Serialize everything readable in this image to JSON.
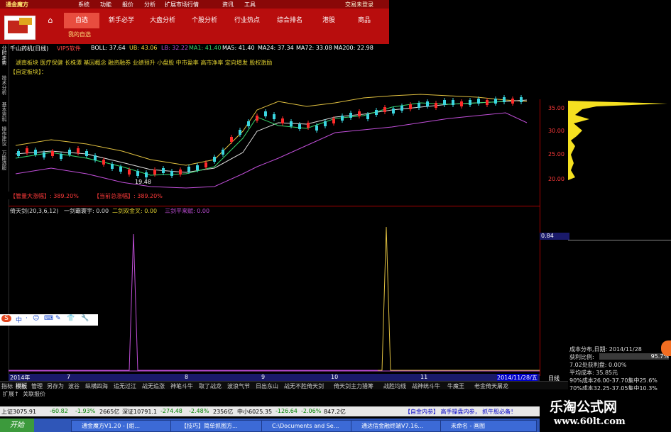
{
  "app": {
    "logo_text": "通金魔方",
    "login_text": "交易未登录",
    "menus": [
      "系统",
      "功能",
      "报价",
      "分析",
      "扩展市场行情",
      "资讯",
      "工具"
    ],
    "nav": [
      "自选",
      "新手必学",
      "大盘分析",
      "个股分析",
      "行业热点",
      "综合排名",
      "港股",
      "商品"
    ],
    "subnav": "我的自选"
  },
  "left_tabs": [
    "分时走势",
    "技术分析",
    "基本资料",
    "操作建议",
    "万能选股"
  ],
  "chart_header": {
    "title": "千山药机(日线)",
    "vip": "VIP5软件",
    "boll": "BOLL: 37.64",
    "ub": "UB: 43.06",
    "lb": "LB: 32.22",
    "ma1": "MA1: 41.40",
    "ma5": "MA5: 41.40",
    "ma24": "MA24: 37.34",
    "ma72": "MA72: 33.08",
    "ma200": "MA200: 22.98"
  },
  "concept_line": "湖南板块 医疗保健 长株潭 基因概念 融资融券 业绩预升 小盘股 中市盈率 高市净率 定向增发 股权激励",
  "custom_block": "【自定板块】：",
  "signals": {
    "left": "【管量大涨幅】: 389.20%",
    "right": "【当前总涨幅】: 389.20%"
  },
  "price_ticks": [
    "35.00",
    "30.00",
    "25.00",
    "20.00"
  ],
  "low_label": "19.48",
  "indicator": {
    "name": "倚天剑(20,3,6,12)",
    "a": "一剑霸寰宇: 0.00",
    "b": "二剑双金叉: 0.00",
    "c": "三剑平来赋: 0.00",
    "value_box": "0.84"
  },
  "dates": [
    "2014年",
    "7",
    "8",
    "9",
    "10",
    "11",
    "2014/11/28/五"
  ],
  "bottom_tabs": [
    "指标",
    "模板",
    "管理",
    "另存为",
    "波谷",
    "纵横四海",
    "追无过江",
    "战无追涨",
    "神笔斗牛",
    "取了战龙",
    "波浪气节",
    "日出东山",
    "战无不胜倚天剑",
    "倚天剑主力猎筹",
    "战胜均线",
    "战神统斗牛",
    "牛魔王",
    "老金倚天屠龙"
  ],
  "ext_tabs": [
    "扩展↑",
    "关联报价"
  ],
  "right_date_tab": "日线",
  "cost_panel": {
    "line1": "成本分布,日期: 2014/11/28",
    "line2": "获利比例:",
    "ratio": "95.7%",
    "line3": "7.02处获利盘: 0.00%",
    "line4": "平均成本: 35.85元",
    "line5": "90%成本26.00-37.70集中25.6%",
    "line6": "70%成本32.25-37.05集中10.3%"
  },
  "ticker": {
    "sh": "上证3075.91",
    "sh_chg": "-60.82",
    "sh_pct": "-1.93%",
    "sh_amt": "2665亿",
    "sz": "深证10791.1",
    "sz_chg": "-274.48",
    "sz_pct": "-2.48%",
    "sz_amt": "2356亿",
    "sm": "中小6025.35",
    "sm_chg": "-126.64",
    "sm_pct": "-2.06%",
    "sm_amt": "847.2亿",
    "ad": "【自金内参】 高手操盘内参， 抓牛股必备！"
  },
  "taskbar": {
    "start": "开始",
    "tasks": [
      "通金魔方V1.20 - [组...",
      "【技巧】简单抓图方...",
      "C:\\Documents and Se...",
      "通达信金融终端V7.16...",
      "未命名 - 画图"
    ]
  },
  "watermark": {
    "cn": "乐淘公式网",
    "url": "www.60lt.com"
  },
  "input_bar": [
    "S",
    "中",
    "·",
    "☺",
    "⌨",
    "✎",
    "👕",
    "🔧"
  ]
}
